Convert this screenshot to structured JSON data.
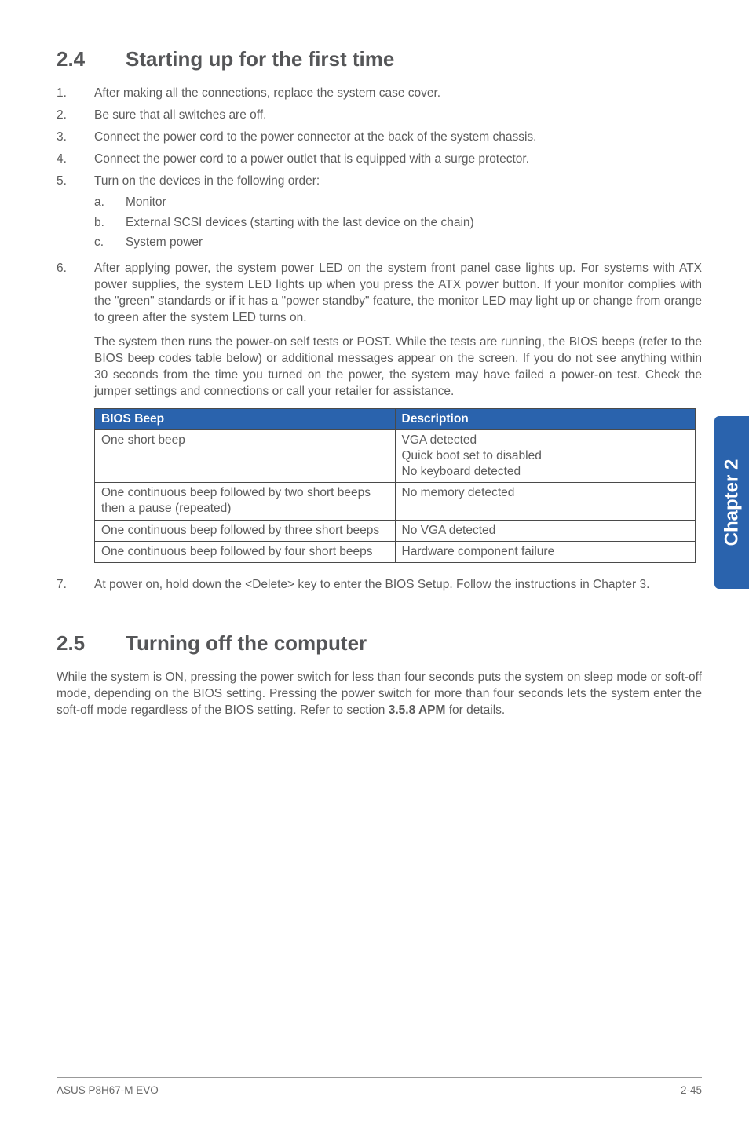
{
  "section1": {
    "number": "2.4",
    "title": "Starting up for the first time",
    "steps": {
      "s1": "After making all the connections, replace the system case cover.",
      "s2": "Be sure that all switches are off.",
      "s3": "Connect the power cord to the power connector at the back of the system chassis.",
      "s4": "Connect the power cord to a power outlet that is equipped with a surge protector.",
      "s5": "Turn on the devices in the following order:",
      "s5a": "Monitor",
      "s5b": "External SCSI devices (starting with the last device on the chain)",
      "s5c": "System power",
      "s6": "After applying power, the system power LED on the system front panel case lights up. For systems with ATX power supplies, the system LED lights up when you press the ATX power button. If your monitor complies with the \"green\" standards or if it has a \"power standby\" feature, the monitor LED may light up or change from orange to green after the system LED turns on.",
      "s6b": "The system then runs the power-on self tests or POST. While the tests are running, the BIOS beeps (refer to the BIOS beep codes table below) or additional messages appear on the screen. If you do not see anything within 30 seconds from the time you turned on the power, the system may have failed a power-on test. Check the jumper settings and connections or call your retailer for assistance.",
      "s7": "At power on, hold down the <Delete> key to enter the BIOS Setup. Follow the instructions in Chapter 3."
    },
    "table": {
      "h1": "BIOS Beep",
      "h2": "Description",
      "rows": [
        {
          "c1": "One short beep",
          "c2": "VGA detected\nQuick boot set to disabled\nNo keyboard detected"
        },
        {
          "c1": "One continuous beep followed by two short beeps then a pause (repeated)",
          "c2": "No memory detected"
        },
        {
          "c1": "One continuous beep followed by three short beeps",
          "c2": "No VGA detected"
        },
        {
          "c1": "One continuous beep followed by four short beeps",
          "c2": "Hardware component failure"
        }
      ]
    }
  },
  "section2": {
    "number": "2.5",
    "title": "Turning off the computer",
    "body_pre": "While the system is ON, pressing the power switch for less than four seconds puts the system on sleep mode or soft-off mode, depending on the BIOS setting. Pressing the power switch for more than four seconds lets the system enter the soft-off mode regardless of the BIOS setting. Refer to section ",
    "body_bold": "3.5.8 APM",
    "body_post": " for details."
  },
  "sidebar": "Chapter 2",
  "footer": {
    "left": "ASUS P8H67-M EVO",
    "right": "2-45"
  },
  "nums": {
    "n1": "1.",
    "n2": "2.",
    "n3": "3.",
    "n4": "4.",
    "n5": "5.",
    "n6": "6.",
    "n7": "7.",
    "a": "a.",
    "b": "b.",
    "c": "c."
  }
}
